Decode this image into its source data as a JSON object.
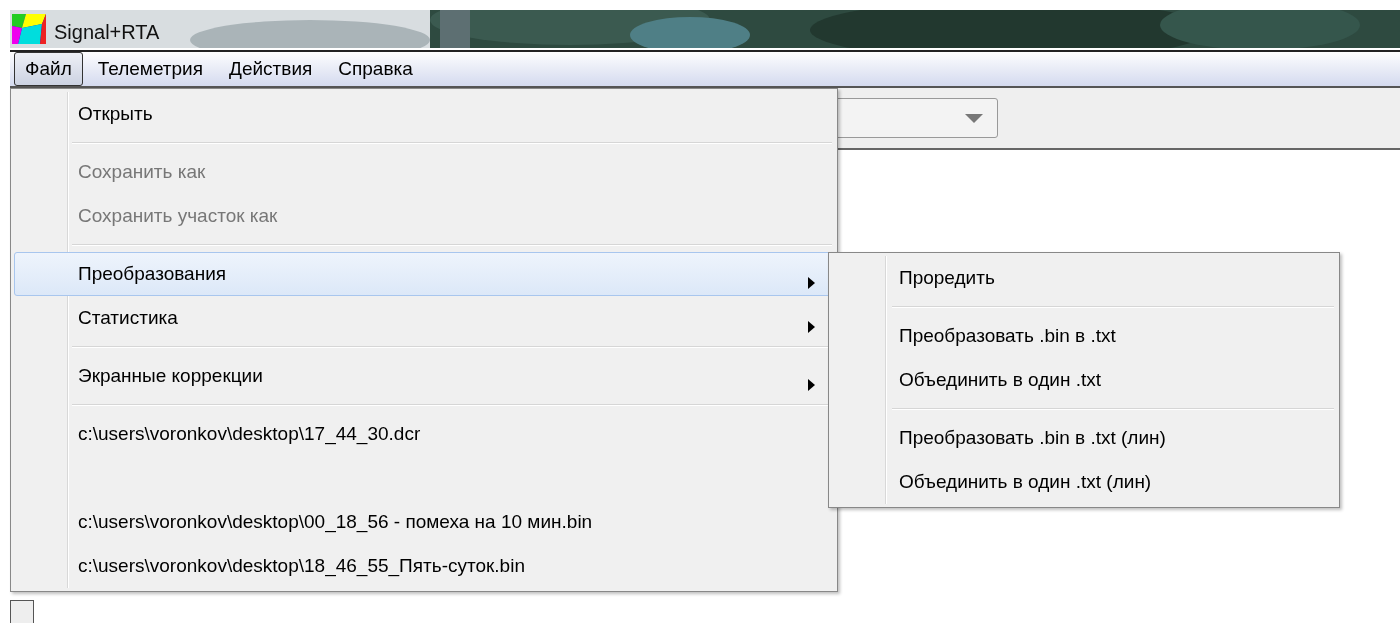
{
  "window": {
    "title": "Signal+RTA"
  },
  "menubar": [
    {
      "label": "Файл",
      "selected": true
    },
    {
      "label": "Телеметрия",
      "selected": false
    },
    {
      "label": "Действия",
      "selected": false
    },
    {
      "label": "Справка",
      "selected": false
    }
  ],
  "file_menu": [
    {
      "kind": "item",
      "label": "Открыть",
      "disabled": false,
      "selected": false,
      "submenu": false
    },
    {
      "kind": "separator"
    },
    {
      "kind": "item",
      "label": "Сохранить как",
      "disabled": true,
      "selected": false,
      "submenu": false
    },
    {
      "kind": "item",
      "label": "Сохранить участок как",
      "disabled": true,
      "selected": false,
      "submenu": false
    },
    {
      "kind": "separator"
    },
    {
      "kind": "item",
      "label": "Преобразования",
      "disabled": false,
      "selected": true,
      "submenu": true
    },
    {
      "kind": "item",
      "label": "Статистика",
      "disabled": false,
      "selected": false,
      "submenu": true
    },
    {
      "kind": "separator"
    },
    {
      "kind": "item",
      "label": "Экранные коррекции",
      "disabled": false,
      "selected": false,
      "submenu": true
    },
    {
      "kind": "separator"
    },
    {
      "kind": "item",
      "label": "c:\\users\\voronkov\\desktop\\17_44_30.dcr",
      "disabled": false,
      "selected": false,
      "submenu": false
    },
    {
      "kind": "blank"
    },
    {
      "kind": "item",
      "label": "c:\\users\\voronkov\\desktop\\00_18_56 - помеха на 10 мин.bin",
      "disabled": false,
      "selected": false,
      "submenu": false
    },
    {
      "kind": "item",
      "label": "c:\\users\\voronkov\\desktop\\18_46_55_Пять-суток.bin",
      "disabled": false,
      "selected": false,
      "submenu": false
    }
  ],
  "submenu": [
    {
      "kind": "item",
      "label": "Проредить"
    },
    {
      "kind": "separator"
    },
    {
      "kind": "item",
      "label": "Преобразовать .bin в .txt"
    },
    {
      "kind": "item",
      "label": "Объединить в один .txt"
    },
    {
      "kind": "separator"
    },
    {
      "kind": "item",
      "label": "Преобразовать .bin в .txt (лин)"
    },
    {
      "kind": "item",
      "label": "Объединить в один .txt (лин)"
    }
  ]
}
